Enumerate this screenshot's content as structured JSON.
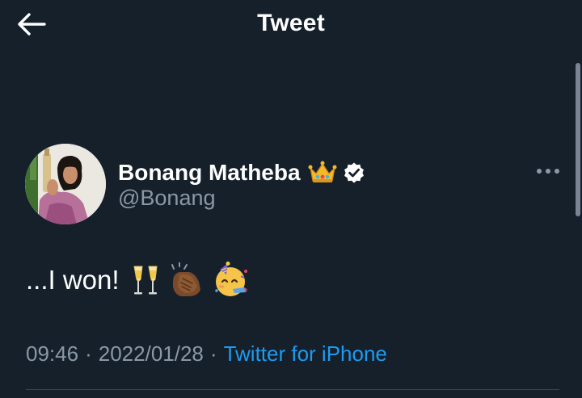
{
  "header": {
    "title": "Tweet",
    "back_icon": "arrow-left-icon"
  },
  "author": {
    "name": "Bonang Matheba",
    "handle": "@Bonang",
    "name_emoji_icon": "crown-icon",
    "verified_icon": "verified-badge-icon"
  },
  "tweet": {
    "text": "...I won!",
    "emoji_icons": [
      "clinking-glasses-icon",
      "clapping-hands-icon",
      "partying-face-icon"
    ]
  },
  "meta": {
    "time": "09:46",
    "separator": "·",
    "date": "2022/01/28",
    "source": "Twitter for iPhone"
  },
  "more_icon": "more-options-icon",
  "colors": {
    "background": "#15202b",
    "text_primary": "#ffffff",
    "text_secondary": "#8b98a5",
    "link": "#1d9bf0",
    "divider": "#38444d"
  }
}
